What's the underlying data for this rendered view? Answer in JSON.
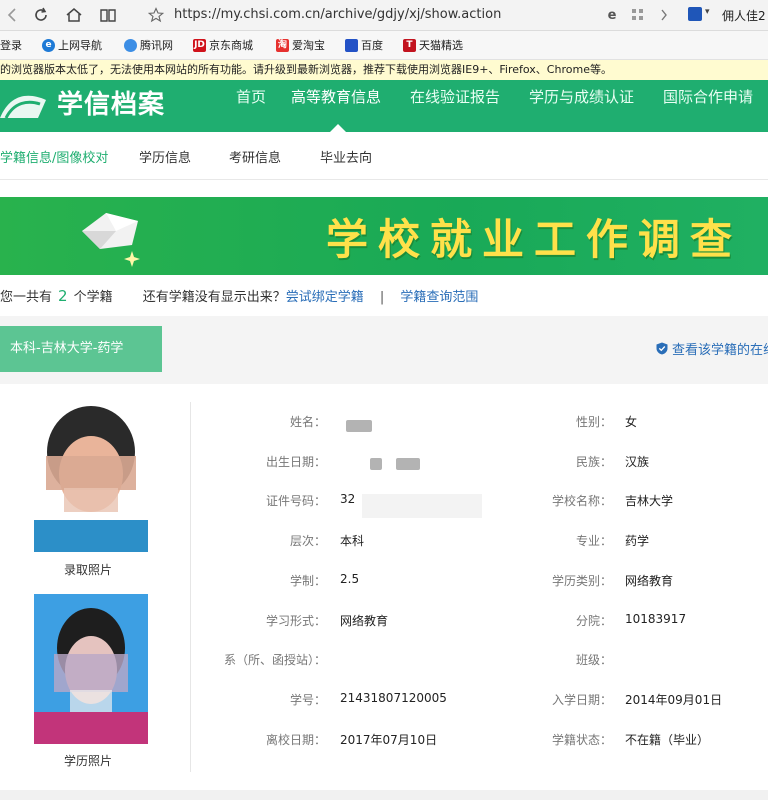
{
  "browser": {
    "url": "https://my.chsi.com.cn/archive/gdjy/xj/show.action",
    "user_name": "佣人佳2"
  },
  "bookmarks": {
    "login": "登录",
    "items": [
      "上网导航",
      "腾讯网",
      "京东商城",
      "爱淘宝",
      "百度",
      "天猫精选"
    ]
  },
  "warning": "的浏览器版本太低了，无法使用本网站的所有功能。请升级到最新浏览器，推荐下载使用浏览器IE9+、Firefox、Chrome等。",
  "site": {
    "logo": "学信档案",
    "nav": [
      "首页",
      "高等教育信息",
      "在线验证报告",
      "学历与成绩认证",
      "国际合作申请"
    ]
  },
  "sub_nav": [
    "学籍信息/图像校对",
    "学历信息",
    "考研信息",
    "毕业去向"
  ],
  "banner": "学校就业工作调查",
  "summary": {
    "prefix": "您一共有",
    "count": "2",
    "suffix": "个学籍",
    "question": "还有学籍没有显示出来？",
    "bind_link": "尝试绑定学籍",
    "sep": "|",
    "scope_link": "学籍查询范围"
  },
  "record": {
    "tab": "本科-吉林大学-药学",
    "verify_link": "查看该学籍的在线"
  },
  "photos": {
    "admission_caption": "录取照片",
    "degree_caption": "学历照片"
  },
  "fields_left": [
    {
      "label": "姓名：",
      "value": ""
    },
    {
      "label": "出生日期：",
      "value": ""
    },
    {
      "label": "证件号码：",
      "value": "32"
    },
    {
      "label": "层次：",
      "value": "本科"
    },
    {
      "label": "学制：",
      "value": "2.5"
    },
    {
      "label": "学习形式：",
      "value": "网络教育"
    },
    {
      "label": "系（所、函授站）：",
      "value": ""
    },
    {
      "label": "学号：",
      "value": "21431807120005"
    },
    {
      "label": "离校日期：",
      "value": "2017年07月10日"
    }
  ],
  "fields_right": [
    {
      "label": "性别：",
      "value": "女"
    },
    {
      "label": "民族：",
      "value": "汉族"
    },
    {
      "label": "学校名称：",
      "value": "吉林大学"
    },
    {
      "label": "专业：",
      "value": "药学"
    },
    {
      "label": "学历类别：",
      "value": "网络教育"
    },
    {
      "label": "分院：",
      "value": "10183917"
    },
    {
      "label": "班级：",
      "value": ""
    },
    {
      "label": "入学日期：",
      "value": "2014年09月01日"
    },
    {
      "label": "学籍状态：",
      "value": "不在籍（毕业）"
    }
  ],
  "colors": {
    "brand_green": "#1fae70",
    "link_blue": "#2a6eb8",
    "banner_text": "#ffe14a"
  }
}
